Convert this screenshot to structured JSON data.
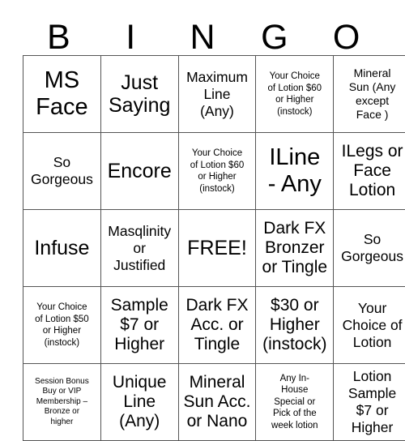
{
  "card": {
    "title": "BINGO",
    "header_letters": [
      "B",
      "I",
      "N",
      "G",
      "O"
    ],
    "free_space_label": "FREE!",
    "grid_line_color": "#555555",
    "text_color": "#000000",
    "background_color": "#ffffff",
    "rows": 5,
    "columns": 5,
    "cells": [
      [
        {
          "text": "MS\nFace",
          "size": "s-xxl"
        },
        {
          "text": "Just\nSaying",
          "size": "s-xl"
        },
        {
          "text": "Maximum\nLine\n(Any)",
          "size": "s-md"
        },
        {
          "text": "Your Choice\nof Lotion $60\nor Higher\n(instock)",
          "size": "s-xs"
        },
        {
          "text": "Mineral\nSun (Any\nexcept\nFace )",
          "size": "s-sm"
        }
      ],
      [
        {
          "text": "So\nGorgeous",
          "size": "s-md"
        },
        {
          "text": "Encore",
          "size": "s-xl"
        },
        {
          "text": "Your Choice\nof Lotion $60\nor Higher\n(instock)",
          "size": "s-xs"
        },
        {
          "text": "ILine\n- Any",
          "size": "s-xxl"
        },
        {
          "text": "ILegs or\nFace\nLotion",
          "size": "s-lg"
        }
      ],
      [
        {
          "text": "Infuse",
          "size": "s-xl"
        },
        {
          "text": "Masqlinity\nor\nJustified",
          "size": "s-md"
        },
        {
          "text": "FREE!",
          "size": "s-xl"
        },
        {
          "text": "Dark FX\nBronzer\nor Tingle",
          "size": "s-lg"
        },
        {
          "text": "So\nGorgeous",
          "size": "s-md"
        }
      ],
      [
        {
          "text": "Your Choice\nof Lotion $50\nor Higher\n(instock)",
          "size": "s-xs"
        },
        {
          "text": "Sample\n$7 or\nHigher",
          "size": "s-lg"
        },
        {
          "text": "Dark FX\nAcc. or\nTingle",
          "size": "s-lg"
        },
        {
          "text": "$30 or\nHigher\n(instock)",
          "size": "s-lg"
        },
        {
          "text": "Your\nChoice of\nLotion",
          "size": "s-md"
        }
      ],
      [
        {
          "text": "Session Bonus\nBuy or VIP\nMembership –\nBronze or\nhigher",
          "size": "s-xxs"
        },
        {
          "text": "Unique\nLine\n(Any)",
          "size": "s-lg"
        },
        {
          "text": "Mineral\nSun Acc.\nor Nano",
          "size": "s-lg"
        },
        {
          "text": "Any In-\nHouse\nSpecial or\nPick of the\nweek lotion",
          "size": "s-xs"
        },
        {
          "text": "Lotion\nSample\n$7 or\nHigher",
          "size": "s-md"
        }
      ]
    ]
  }
}
